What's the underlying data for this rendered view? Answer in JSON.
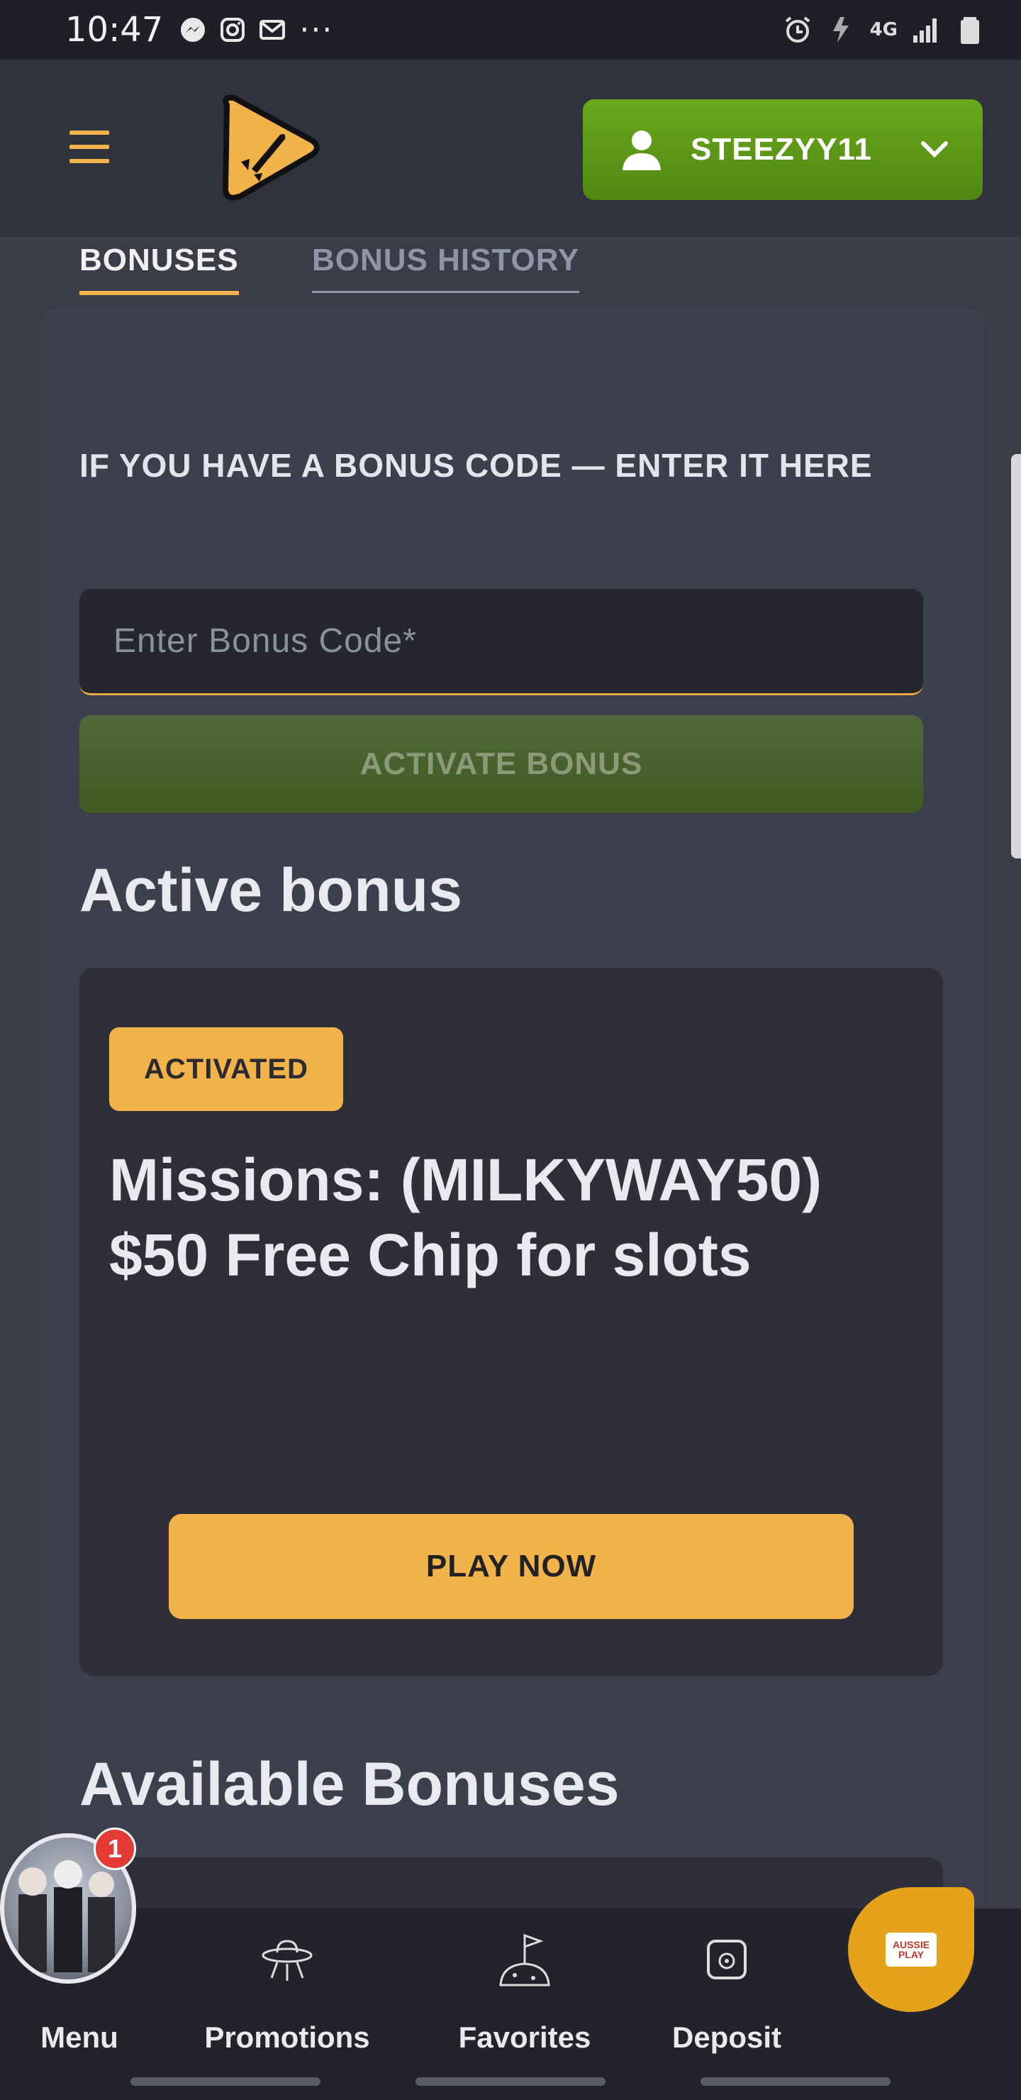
{
  "status_bar": {
    "time": "10:47",
    "left_icons": [
      "messenger-icon",
      "instagram-icon",
      "mail-icon"
    ],
    "more": "···",
    "network": "4G",
    "right_icons": [
      "alarm-icon",
      "data-icon",
      "signal-icon",
      "battery-icon"
    ]
  },
  "header": {
    "menu_icon": "hamburger-icon",
    "logo_icon": "rocket-play-logo",
    "user": {
      "username": "STEEZYY11",
      "icon": "user-icon",
      "dropdown_icon": "chevron-down-icon"
    }
  },
  "tabs": [
    {
      "label": "BONUSES",
      "active": true
    },
    {
      "label": "BONUS HISTORY",
      "active": false
    }
  ],
  "bonus_code": {
    "heading": "IF YOU HAVE A BONUS CODE — ENTER IT HERE",
    "placeholder": "Enter Bonus Code*",
    "value": "",
    "button_label": "ACTIVATE BONUS"
  },
  "active_bonus": {
    "section_title": "Active bonus",
    "status": "ACTIVATED",
    "title": "Missions: (MILKYWAY50) $50 Free Chip for slots",
    "button_label": "PLAY NOW"
  },
  "available_bonuses": {
    "section_title": "Available Bonuses"
  },
  "bottom_nav": {
    "items": [
      {
        "label": "Menu",
        "icon": "avatar-icon"
      },
      {
        "label": "Promotions",
        "icon": "ufo-icon"
      },
      {
        "label": "Favorites",
        "icon": "moon-flag-icon"
      },
      {
        "label": "Deposit",
        "icon": "safe-icon"
      }
    ],
    "notification_count": "1",
    "chat_label": "AUSSIE PLAY"
  },
  "colors": {
    "accent": "#f2b34a",
    "green": "#5a9716",
    "background": "#3a3c48",
    "card": "#2e2f38"
  }
}
